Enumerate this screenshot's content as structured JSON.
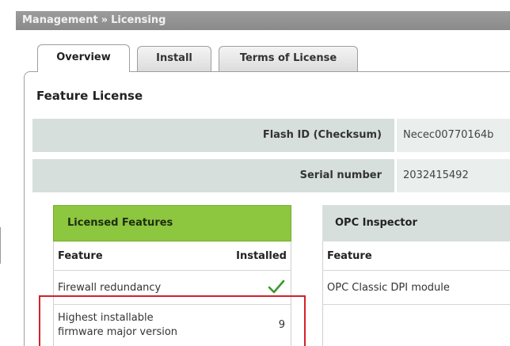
{
  "breadcrumb": {
    "items": [
      "Management",
      "Licensing"
    ],
    "separator": "»"
  },
  "tabs": [
    {
      "label": "Overview",
      "active": true
    },
    {
      "label": "Install",
      "active": false
    },
    {
      "label": "Terms of License",
      "active": false
    }
  ],
  "section_title": "Feature License",
  "info_rows": [
    {
      "label": "Flash ID (Checksum)",
      "value": "Nec­ec00770164b"
    },
    {
      "label": "Serial number",
      "value": "2032415492"
    }
  ],
  "licensed_features": {
    "title": "Licensed Features",
    "columns": [
      "Feature",
      "Installed"
    ],
    "rows": [
      {
        "feature": "Firewall redundancy",
        "installed_icon": "check-icon"
      },
      {
        "feature_lines": [
          "Highest installable",
          "firmware major version"
        ],
        "installed": "9"
      }
    ]
  },
  "opc_inspector": {
    "title": "OPC Inspector",
    "columns": [
      "Feature"
    ],
    "rows": [
      {
        "feature": "OPC Classic DPI module"
      }
    ]
  },
  "colors": {
    "header_bar": "#8f8f8f",
    "licensed_header": "#8dc63f",
    "info_label_bg": "#d7dfdd",
    "highlight": "#d4202a",
    "check": "#3a9a2a"
  }
}
